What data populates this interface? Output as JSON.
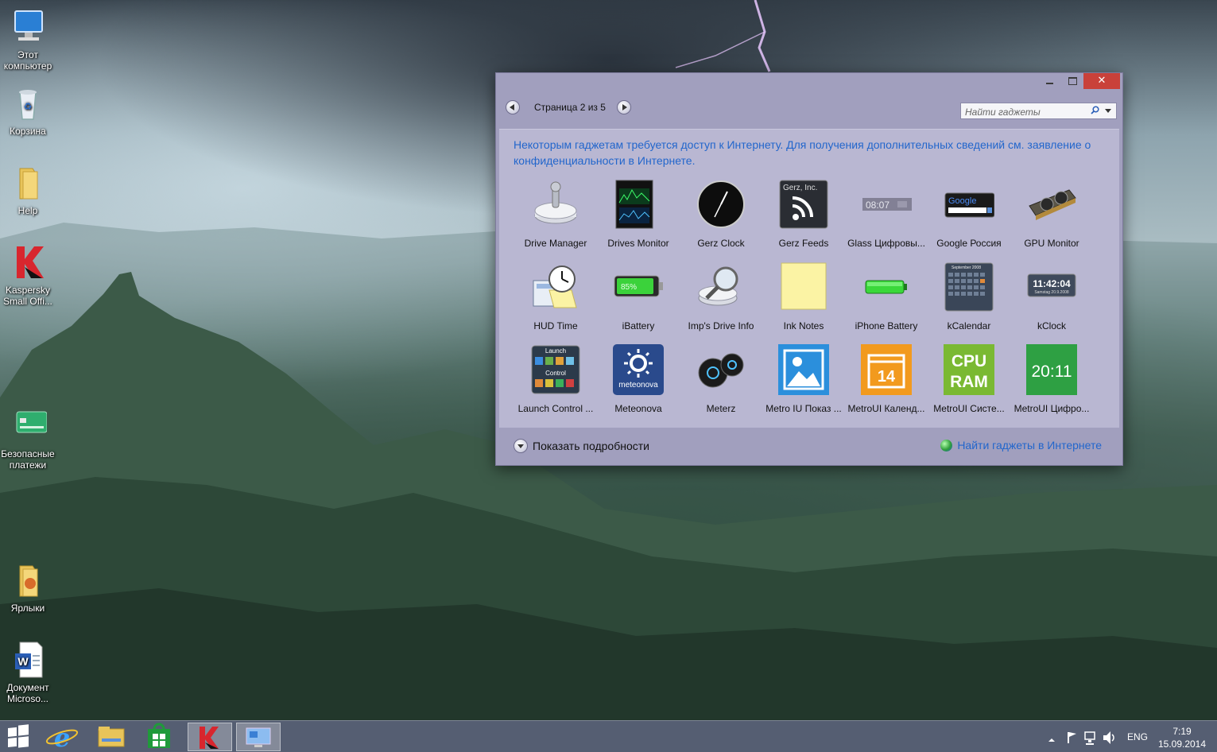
{
  "desktop": {
    "icons": [
      {
        "label": "Этот\nкомпьютер",
        "icon": "computer-icon"
      },
      {
        "label": "Корзина",
        "icon": "recycle-bin-icon"
      },
      {
        "label": "Help",
        "icon": "folder-icon"
      },
      {
        "label": "Kaspersky\nSmall Offi...",
        "icon": "kaspersky-icon"
      },
      {
        "label": "Безопасные\nплатежи",
        "icon": "safe-payments-icon"
      },
      {
        "label": "Ярлыки",
        "icon": "shortcuts-folder-icon"
      },
      {
        "label": "Документ\nMicroso...",
        "icon": "word-document-icon"
      }
    ]
  },
  "window": {
    "pager": {
      "label": "Страница 2 из 5"
    },
    "search": {
      "placeholder": "Найти гаджеты"
    },
    "notice": "Некоторым гаджетам требуется доступ к Интернету. Для получения дополнительных сведений см. заявление о конфиденциальности в Интернете.",
    "gadgets": [
      {
        "label": "Drive Manager",
        "icon": "drive-manager-icon"
      },
      {
        "label": "Drives Monitor",
        "icon": "drives-monitor-icon"
      },
      {
        "label": "Gerz Clock",
        "icon": "clock-icon"
      },
      {
        "label": "Gerz Feeds",
        "icon": "rss-feed-icon",
        "text": "Gerz, Inc."
      },
      {
        "label": "Glass Цифровы...",
        "icon": "glass-digital-clock-icon",
        "text": "08:07"
      },
      {
        "label": "Google Россия",
        "icon": "google-search-icon",
        "text": "Google"
      },
      {
        "label": "GPU Monitor",
        "icon": "graphics-card-icon"
      },
      {
        "label": "HUD Time",
        "icon": "hud-time-icon"
      },
      {
        "label": "iBattery",
        "icon": "battery-icon",
        "text": "85%"
      },
      {
        "label": "Imp's Drive Info",
        "icon": "drive-info-icon"
      },
      {
        "label": "Ink Notes",
        "icon": "sticky-note-icon"
      },
      {
        "label": "iPhone Battery",
        "icon": "iphone-battery-icon"
      },
      {
        "label": "kCalendar",
        "icon": "calendar-icon",
        "text": "September 2008"
      },
      {
        "label": "kClock",
        "icon": "digital-clock-icon",
        "text": "11:42:04",
        "subtext": "Samstag 20.9.2008"
      },
      {
        "label": "Launch Control ...",
        "icon": "launch-control-icon",
        "text": "Launch",
        "subtext": "Control"
      },
      {
        "label": "Meteonova",
        "icon": "meteonova-icon",
        "text": "meteonova"
      },
      {
        "label": "Meterz",
        "icon": "meterz-icon"
      },
      {
        "label": "Metro IU Показ ...",
        "icon": "photo-slideshow-icon"
      },
      {
        "label": "MetroUI Календ...",
        "icon": "metro-calendar-icon",
        "text": "14"
      },
      {
        "label": "MetroUI Систе...",
        "icon": "cpu-ram-icon",
        "text": "CPU",
        "subtext": "RAM"
      },
      {
        "label": "MetroUI Цифро...",
        "icon": "metro-clock-icon",
        "text": "20:11"
      }
    ],
    "details_label": "Показать подробности",
    "online_link": "Найти гаджеты в Интернете"
  },
  "taskbar": {
    "items": [
      "start-icon",
      "internet-explorer-icon",
      "file-explorer-icon",
      "store-icon",
      "kaspersky-icon",
      "gadgets-icon"
    ],
    "language": "ENG",
    "time": "7:19",
    "date": "15.09.2014"
  },
  "colors": {
    "window_bg": "#a19fbe",
    "content_bg": "#b9b7d2",
    "link": "#2266cc",
    "close_button": "#c9413a"
  }
}
